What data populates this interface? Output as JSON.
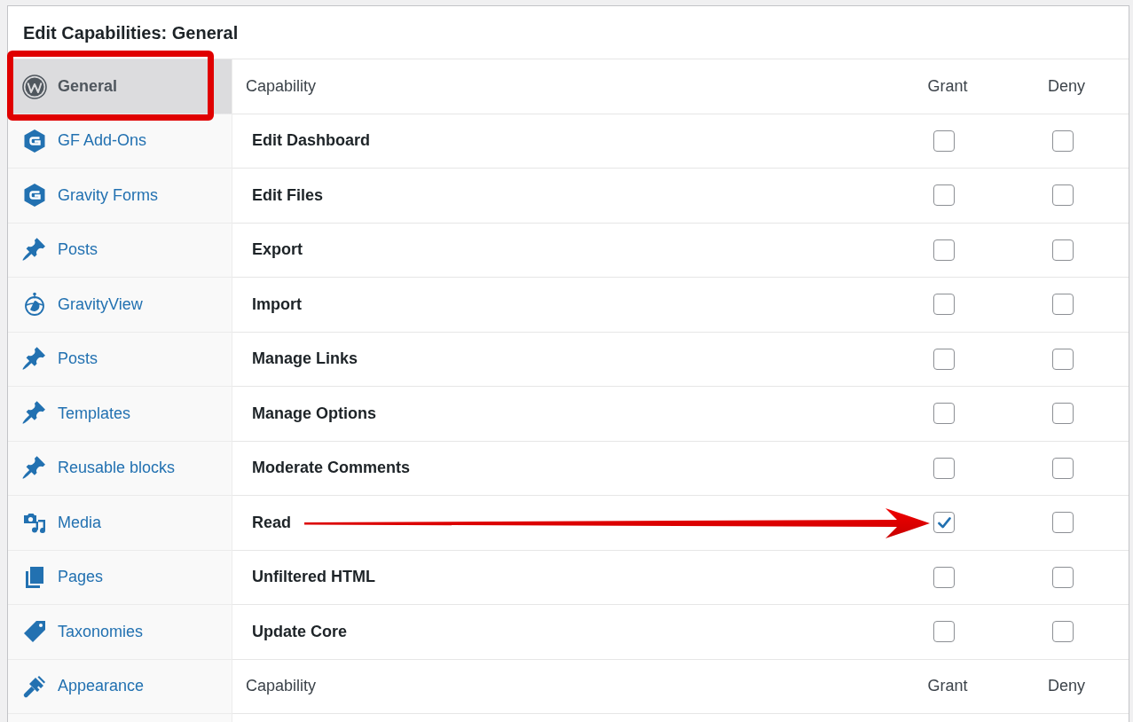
{
  "panel": {
    "title": "Edit Capabilities: General"
  },
  "sidebar": {
    "items": [
      {
        "label": "General",
        "kind": "logo",
        "selected": true,
        "framed": true
      },
      {
        "label": "GF Add-Ons",
        "kind": "forms",
        "selected": false,
        "framed": false
      },
      {
        "label": "Gravity Forms",
        "kind": "forms",
        "selected": false,
        "framed": false
      },
      {
        "label": "Posts",
        "kind": "pin",
        "selected": false,
        "framed": false
      },
      {
        "label": "GravityView",
        "kind": "view",
        "selected": false,
        "framed": false
      },
      {
        "label": "Posts",
        "kind": "pin",
        "selected": false,
        "framed": false
      },
      {
        "label": "Templates",
        "kind": "pin",
        "selected": false,
        "framed": false
      },
      {
        "label": "Reusable blocks",
        "kind": "pin",
        "selected": false,
        "framed": false
      },
      {
        "label": "Media",
        "kind": "media",
        "selected": false,
        "framed": false
      },
      {
        "label": "Pages",
        "kind": "pages",
        "selected": false,
        "framed": false
      },
      {
        "label": "Taxonomies",
        "kind": "tag",
        "selected": false,
        "framed": false
      },
      {
        "label": "Appearance",
        "kind": "brush",
        "selected": false,
        "framed": false
      }
    ]
  },
  "table": {
    "columns": [
      "Capability",
      "Grant",
      "Deny"
    ],
    "rows": [
      {
        "capability": "Edit Dashboard",
        "grant": false,
        "deny": false,
        "arrow": false
      },
      {
        "capability": "Edit Files",
        "grant": false,
        "deny": false,
        "arrow": false
      },
      {
        "capability": "Export",
        "grant": false,
        "deny": false,
        "arrow": false
      },
      {
        "capability": "Import",
        "grant": false,
        "deny": false,
        "arrow": false
      },
      {
        "capability": "Manage Links",
        "grant": false,
        "deny": false,
        "arrow": false
      },
      {
        "capability": "Manage Options",
        "grant": false,
        "deny": false,
        "arrow": false
      },
      {
        "capability": "Moderate Comments",
        "grant": false,
        "deny": false,
        "arrow": false
      },
      {
        "capability": "Read",
        "grant": true,
        "deny": false,
        "arrow": true
      },
      {
        "capability": "Unfiltered HTML",
        "grant": false,
        "deny": false,
        "arrow": false
      },
      {
        "capability": "Update Core",
        "grant": false,
        "deny": false,
        "arrow": false
      }
    ],
    "footer_columns": [
      "Capability",
      "Grant",
      "Deny"
    ]
  }
}
